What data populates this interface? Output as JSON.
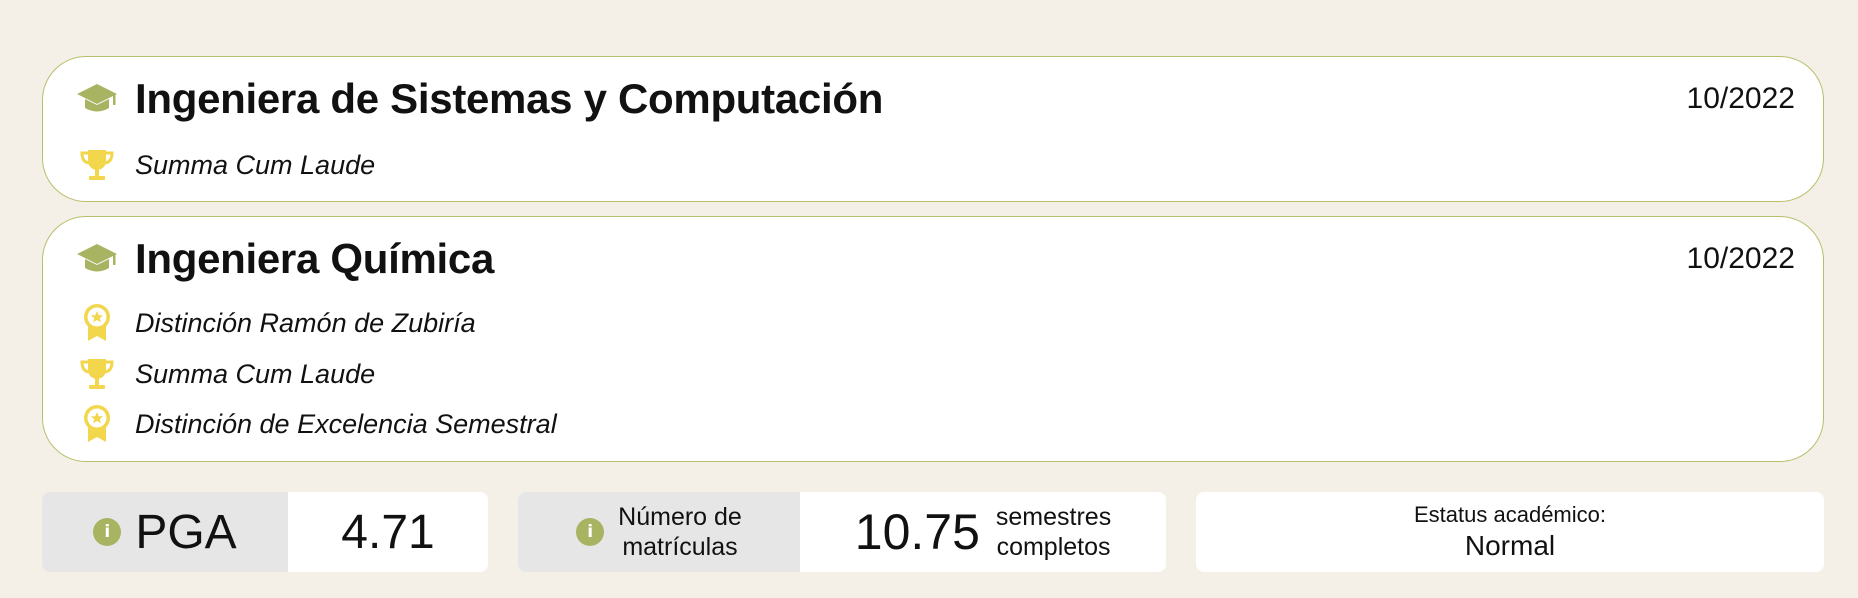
{
  "degrees": [
    {
      "title": "Ingeniera de Sistemas y Computación",
      "date": "10/2022",
      "honors": [
        {
          "icon": "trophy-icon",
          "label": "Summa Cum Laude"
        }
      ]
    },
    {
      "title": "Ingeniera Química",
      "date": "10/2022",
      "honors": [
        {
          "icon": "medal-icon",
          "label": "Distinción Ramón de Zubiría"
        },
        {
          "icon": "trophy-icon",
          "label": "Summa Cum Laude"
        },
        {
          "icon": "medal-icon",
          "label": "Distinción de Excelencia Semestral"
        }
      ]
    }
  ],
  "stats": {
    "pga": {
      "label": "PGA",
      "value": "4.71"
    },
    "matriculas": {
      "label_line1": "Número de",
      "label_line2": "matrículas",
      "value": "10.75",
      "unit_line1": "semestres",
      "unit_line2": "completos"
    },
    "status": {
      "label": "Estatus académico:",
      "value": "Normal"
    }
  },
  "colors": {
    "background": "#f4f0e8",
    "accent_green": "#a8b462",
    "honor_yellow": "#f2d64b",
    "card_border": "#b8bf6a"
  }
}
